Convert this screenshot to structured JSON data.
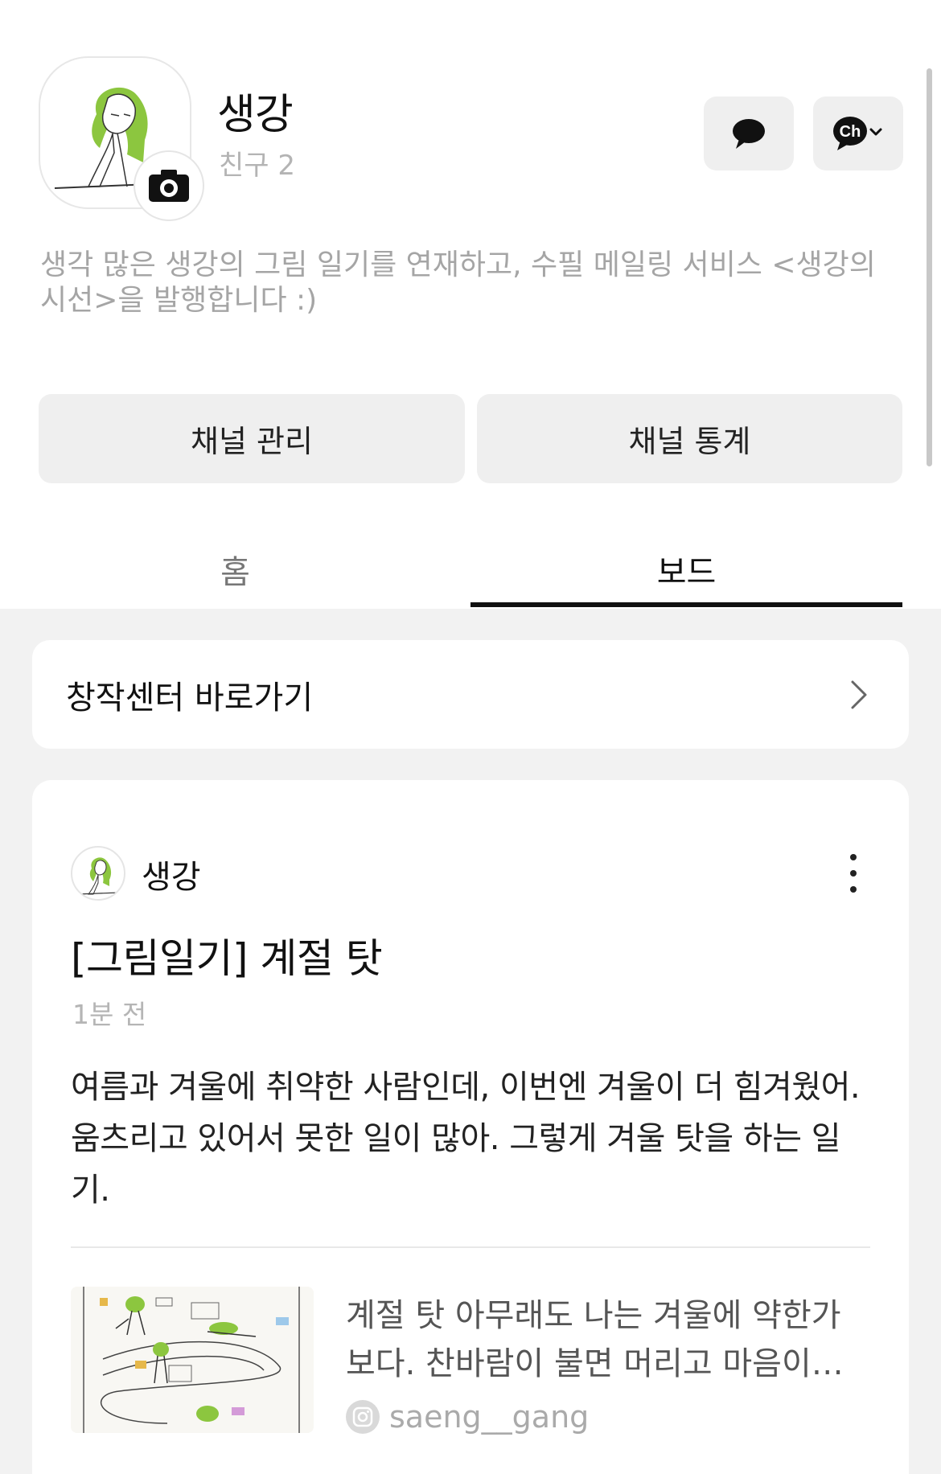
{
  "profile": {
    "name": "생강",
    "friends": "친구 2",
    "description": "생각 많은 생강의 그림 일기를 연재하고, 수필 메일링 서비스 <생강의 시선>을 발행합니다 :)",
    "avatar_icon": "illustrated-avatar",
    "camera_icon": "camera-icon"
  },
  "actions": {
    "chat_icon": "chat-bubble-icon",
    "channel_label": "Ch"
  },
  "buttons": {
    "manage": "채널 관리",
    "stats": "채널 통계"
  },
  "tabs": [
    {
      "label": "홈",
      "active": false
    },
    {
      "label": "보드",
      "active": true
    }
  ],
  "creator_center": {
    "label": "창작센터 바로가기"
  },
  "post": {
    "author": "생강",
    "title": "[그림일기] 계절 탓",
    "time": "1분 전",
    "body": "여름과 겨울에 취약한 사람인데, 이번엔 겨울이 더 힘겨웠어. 움츠리고 있어서 못한 일이 많아. 그렇게 겨울 탓을 하는 일기.",
    "link": {
      "line1": "계절 탓   아무래도 나는 겨울에 약한가",
      "line2": "보다. 찬바람이 불면 머리고 마음이고…",
      "source": "saeng__gang",
      "source_icon": "instagram-icon"
    }
  },
  "colors": {
    "accent_green": "#8cc63f",
    "background_gray": "#f2f2f2",
    "button_gray": "#efefef"
  }
}
